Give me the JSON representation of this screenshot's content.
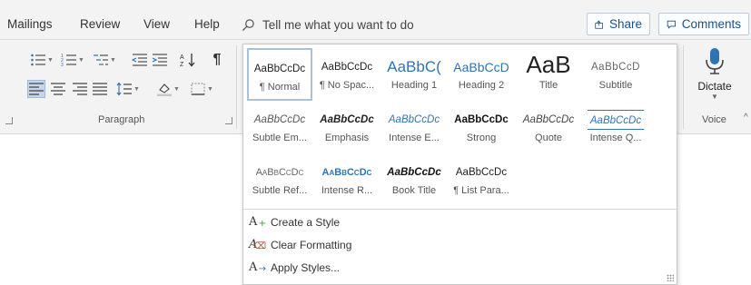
{
  "tabs": {
    "mailings": "Mailings",
    "review": "Review",
    "view": "View",
    "help": "Help"
  },
  "tell_me": "Tell me what you want to do",
  "share_label": "Share",
  "comments_label": "Comments",
  "paragraph_group_label": "Paragraph",
  "voice_group_label": "Voice",
  "dictate_label": "Dictate",
  "styles": {
    "row1": [
      {
        "preview": "AaBbCcDc",
        "name": "¶ Normal"
      },
      {
        "preview": "AaBbCcDc",
        "name": "¶ No Spac..."
      },
      {
        "preview": "AaBbC(",
        "name": "Heading 1"
      },
      {
        "preview": "AaBbCcD",
        "name": "Heading 2"
      },
      {
        "preview": "AaB",
        "name": "Title"
      },
      {
        "preview": "AaBbCcD",
        "name": "Subtitle"
      }
    ],
    "row2": [
      {
        "preview": "AaBbCcDc",
        "name": "Subtle Em..."
      },
      {
        "preview": "AaBbCcDc",
        "name": "Emphasis"
      },
      {
        "preview": "AaBbCcDc",
        "name": "Intense E..."
      },
      {
        "preview": "AaBbCcDc",
        "name": "Strong"
      },
      {
        "preview": "AaBbCcDc",
        "name": "Quote"
      },
      {
        "preview": "AaBbCcDc",
        "name": "Intense Q..."
      }
    ],
    "row3": [
      {
        "preview": "AaBbCcDc",
        "name": "Subtle Ref..."
      },
      {
        "preview": "AaBbCcDc",
        "name": "Intense R..."
      },
      {
        "preview": "AaBbCcDc",
        "name": "Book Title"
      },
      {
        "preview": "AaBbCcDc",
        "name": "¶ List Para..."
      }
    ]
  },
  "commands": {
    "create_style": "Create a Style",
    "clear_formatting": "Clear Formatting",
    "apply_styles": "Apply Styles..."
  },
  "colors": {
    "accent_blue": "#1b4f8b",
    "heading_blue": "#2e74b5",
    "selected_border": "#a9c1dc"
  }
}
